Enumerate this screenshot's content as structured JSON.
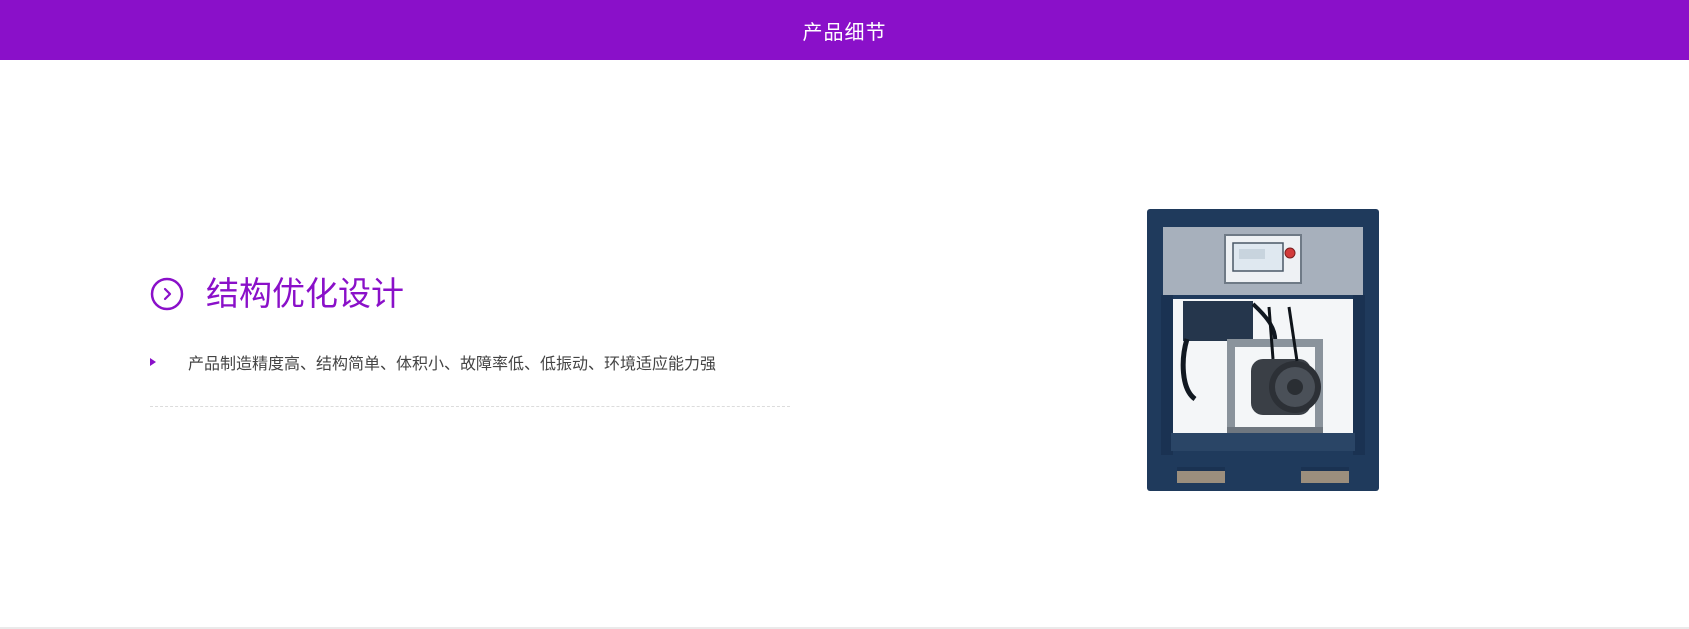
{
  "header": {
    "title": "产品细节",
    "background_color": "#8a10c9"
  },
  "feature": {
    "icon": "chevron-right-circle-icon",
    "title": "结构优化设计",
    "items": [
      {
        "icon": "triangle-bullet-icon",
        "text": "产品制造精度高、结构简单、体积小、故障率低、低振动、环境适应能力强"
      }
    ]
  },
  "product_image": {
    "icon": "air-compressor-image"
  },
  "colors": {
    "accent": "#8a10c9",
    "text": "#444444",
    "divider": "#dcdcdc"
  }
}
